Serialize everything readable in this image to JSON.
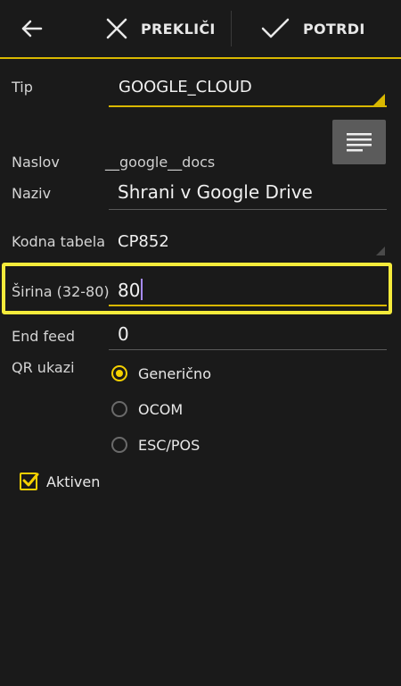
{
  "toolbar": {
    "cancel_label": "PREKLIČI",
    "confirm_label": "POTRDI"
  },
  "form": {
    "tip": {
      "label": "Tip",
      "value": "GOOGLE_CLOUD"
    },
    "naslov": {
      "label": "Naslov",
      "value": "__google__docs"
    },
    "naziv": {
      "label": "Naziv",
      "value": "Shrani v Google Drive"
    },
    "kodna_tabela": {
      "label": "Kodna tabela",
      "value": "CP852"
    },
    "sirina": {
      "label": "Širina (32-80)",
      "value": "80"
    },
    "end_feed": {
      "label": "End feed",
      "value": "0"
    },
    "qr_ukazi": {
      "label": "QR ukazi",
      "options": [
        "Generično",
        "OCOM",
        "ESC/POS"
      ],
      "selected": "Generično"
    },
    "aktiven": {
      "label": "Aktiven",
      "checked": true
    }
  },
  "icons": {
    "back": "arrow-left-icon",
    "cancel": "close-icon",
    "confirm": "check-icon",
    "menu": "menu-lines-icon"
  },
  "colors": {
    "accent": "#d9b800",
    "highlight": "#f5eb3b",
    "background": "#1a1a1a",
    "cursor": "#a78bfa"
  }
}
